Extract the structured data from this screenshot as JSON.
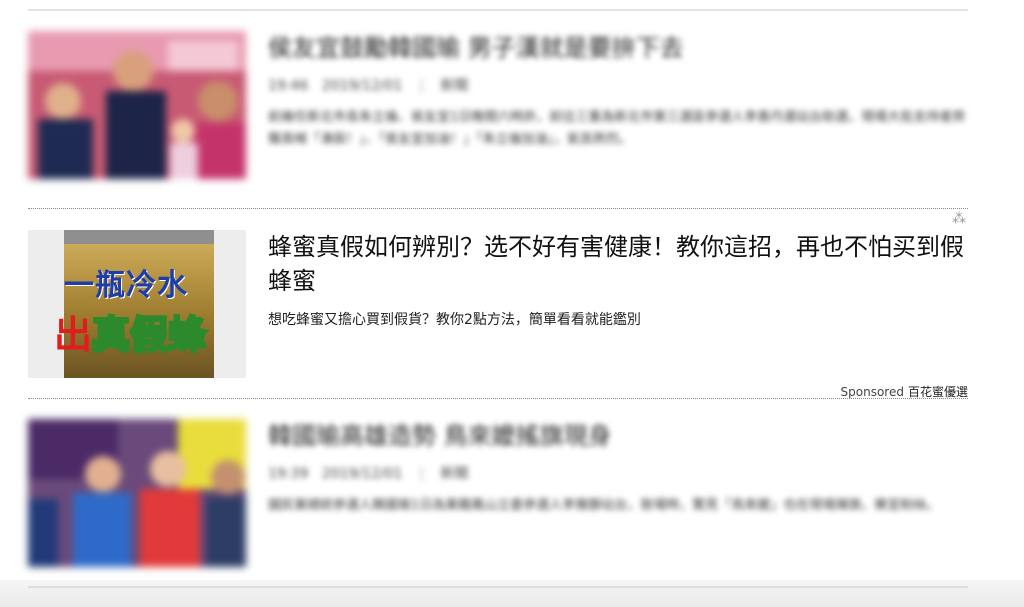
{
  "articles": [
    {
      "title": "侯友宜鼓勵韓國瑜 男子漢就是要拚下去",
      "time": "19:46",
      "date": "2019/12/01",
      "category": "新聞",
      "summary": "前幾任新北市長朱立倫、侯友宜1日晚間六時許，前往三重為新北市第三選區參選人李善丹選站台助選，現場大批支持者齊聲高喊「凍蒜！」、「侯友宜加油！」「朱立倫加油」，氣氛熱烈。"
    },
    {
      "title": "韓國瑜高雄造勢 鳥來嬤搖旗現身",
      "time": "19:39",
      "date": "2019/12/01",
      "category": "新聞",
      "summary": "國民黨總統參選人韓國瑜1日為黨籍鳳山立委參選人李雅靜站台，致場時，驚見「鳥來嬤」也在現場揮旗，樂宣粉絲。"
    }
  ],
  "ad": {
    "title": "蜂蜜真假如何辨別？选不好有害健康！教你這招，再也不怕买到假蜂蜜",
    "description": "想吃蜂蜜又擔心買到假貨？教你2點方法，簡單看看就能鑑別",
    "sponsored_label": "Sponsored",
    "sponsor": "百花蜜優選",
    "thumb_line1": "一瓶冷水",
    "thumb_line2_a": "出",
    "thumb_line2_b": "真假蜂",
    "adchoice_icon": "adchoice-icon"
  },
  "colors": {
    "separator": "#8a8a8a",
    "title": "#222222",
    "ad_blue": "#1d3ea8"
  }
}
